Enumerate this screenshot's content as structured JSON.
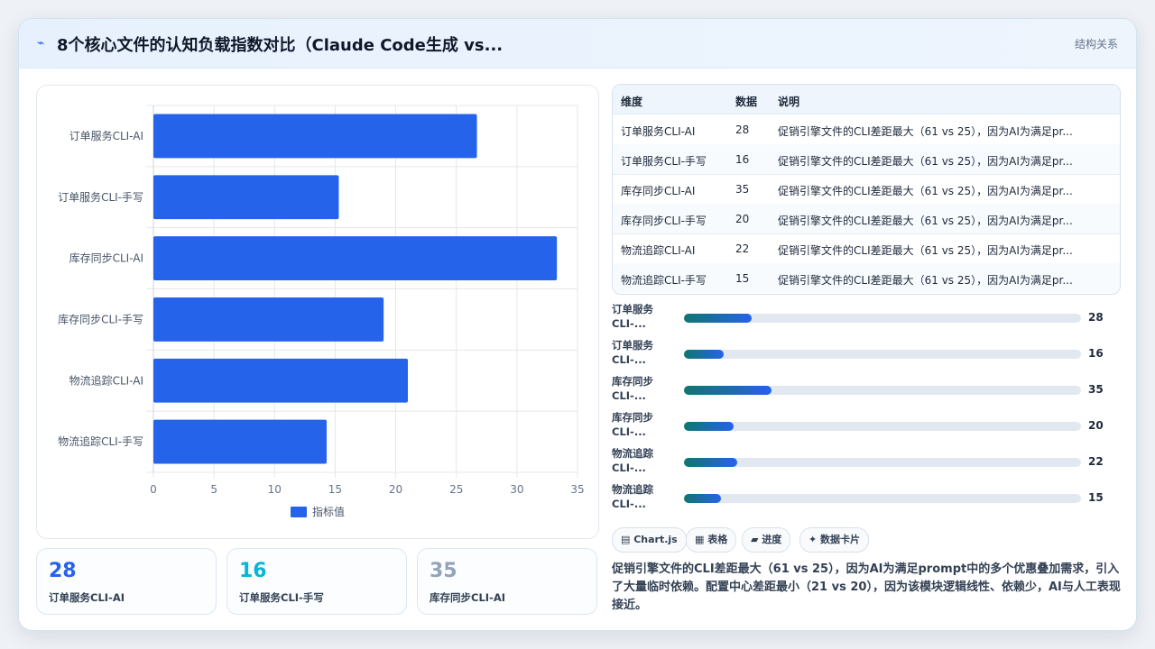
{
  "header": {
    "icon": "bolt-icon",
    "title": "8个核心文件的认知负载指数对比（Claude Code生成 vs...",
    "tag": "结构关系"
  },
  "chart_data": {
    "type": "bar",
    "orientation": "horizontal",
    "categories": [
      "订单服务CLI-AI",
      "订单服务CLI-手写",
      "库存同步CLI-AI",
      "库存同步CLI-手写",
      "物流追踪CLI-AI",
      "物流追踪CLI-手写"
    ],
    "series": [
      {
        "name": "指标值",
        "values": [
          26.7,
          15.3,
          33.3,
          19.0,
          21.0,
          14.3
        ]
      }
    ],
    "xlim": [
      0,
      35
    ],
    "xticks": [
      0,
      5,
      10,
      15,
      20,
      25,
      30,
      35
    ],
    "grid": true,
    "legend": "bottom",
    "color": "#2563eb"
  },
  "stats": [
    {
      "value": "28",
      "label": "订单服务CLI-AI",
      "color": "#2563eb"
    },
    {
      "value": "16",
      "label": "订单服务CLI-手写",
      "color": "#06b6d4"
    },
    {
      "value": "35",
      "label": "库存同步CLI-AI",
      "color": "#94a3b8"
    }
  ],
  "table": {
    "headers": [
      "维度",
      "数据",
      "说明"
    ],
    "rows": [
      [
        "订单服务CLI-AI",
        "28",
        "促销引擎文件的CLI差距最大（61 vs 25），因为AI为满足pr..."
      ],
      [
        "订单服务CLI-手写",
        "16",
        "促销引擎文件的CLI差距最大（61 vs 25），因为AI为满足pr..."
      ],
      [
        "库存同步CLI-AI",
        "35",
        "促销引擎文件的CLI差距最大（61 vs 25），因为AI为满足pr..."
      ],
      [
        "库存同步CLI-手写",
        "20",
        "促销引擎文件的CLI差距最大（61 vs 25），因为AI为满足pr..."
      ],
      [
        "物流追踪CLI-AI",
        "22",
        "促销引擎文件的CLI差距最大（61 vs 25），因为AI为满足pr..."
      ],
      [
        "物流追踪CLI-手写",
        "15",
        "促销引擎文件的CLI差距最大（61 vs 25），因为AI为满足pr..."
      ]
    ]
  },
  "progress": [
    {
      "label": "订单服务CLI-...",
      "value": "28",
      "fraction": 0.17
    },
    {
      "label": "订单服务CLI-...",
      "value": "16",
      "fraction": 0.1
    },
    {
      "label": "库存同步CLI-...",
      "value": "35",
      "fraction": 0.22
    },
    {
      "label": "库存同步CLI-...",
      "value": "20",
      "fraction": 0.125
    },
    {
      "label": "物流追踪CLI-...",
      "value": "22",
      "fraction": 0.135
    },
    {
      "label": "物流追踪CLI-...",
      "value": "15",
      "fraction": 0.093
    }
  ],
  "chips": [
    "▤ Chart.js",
    "▦ 表格",
    "▰ 进度",
    "✦ 数据卡片"
  ],
  "summary": "促销引擎文件的CLI差距最大（61 vs 25），因为AI为满足prompt中的多个优惠叠加需求，引入了大量临时依赖。配置中心差距最小（21 vs 20），因为该模块逻辑线性、依赖少，AI与人工表现接近。"
}
